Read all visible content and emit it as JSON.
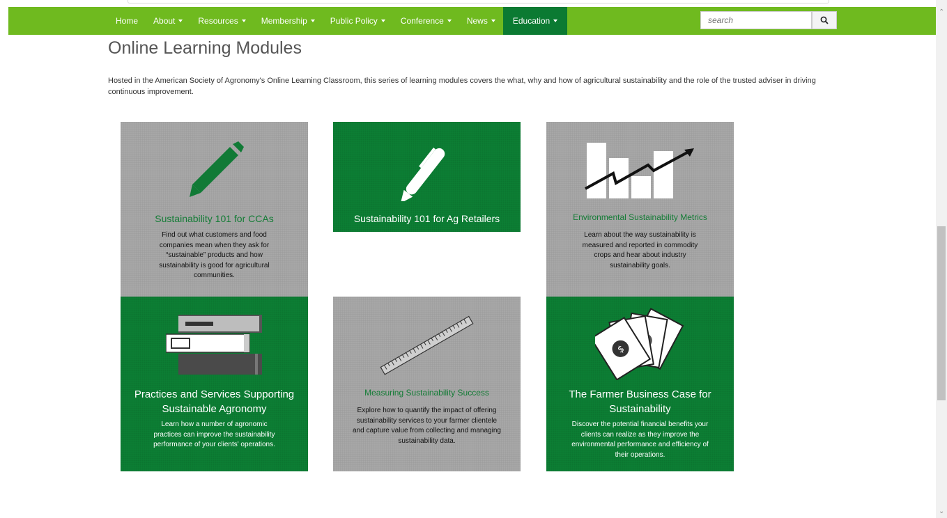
{
  "nav": {
    "items": [
      {
        "label": "Home",
        "caret": false
      },
      {
        "label": "About",
        "caret": true
      },
      {
        "label": "Resources",
        "caret": true
      },
      {
        "label": "Membership",
        "caret": true
      },
      {
        "label": "Public Policy",
        "caret": true
      },
      {
        "label": "Conference",
        "caret": true
      },
      {
        "label": "News",
        "caret": true
      },
      {
        "label": "Education",
        "caret": true,
        "active": true
      }
    ],
    "search_placeholder": "search",
    "search_icon": "magnifier-icon"
  },
  "colors": {
    "nav": "#6fba1f",
    "nav_active": "#0b7a32",
    "tile_green": "#0c7e34",
    "tile_gray": "#a7a7a7",
    "title_green": "#147c36"
  },
  "page": {
    "title": "Online Learning Modules",
    "intro": "Hosted in the American Society of Agronomy's Online Learning Classroom, this series of learning modules covers the what, why and how of agricultural sustainability and the role of the trusted adviser in driving continuous improvement."
  },
  "modules": [
    {
      "title": "Sustainability 101 for CCAs",
      "desc": "Find out what customers and food companies mean when they ask for “sustainable” products and how sustainability is good for agricultural communities.",
      "icon": "pencil-icon",
      "style": "gray"
    },
    {
      "title": "Sustainability 101 for Ag Retailers",
      "desc": "",
      "icon": "pen-icon",
      "style": "green"
    },
    {
      "title": "Environmental Sustainability Metrics",
      "desc": "Learn about the way sustainability is measured and reported in commodity crops and hear about industry sustainability goals.",
      "icon": "bar-chart-icon",
      "style": "gray"
    },
    {
      "title": "Practices and Services Supporting Sustainable Agronomy",
      "desc": "Learn how a number of agronomic practices can improve the sustainability performance of your clients' operations.",
      "icon": "books-icon",
      "style": "green"
    },
    {
      "title": "Measuring Sustainability Success",
      "desc": "Explore how to quantify the impact of offering sustainability services to your farmer clientele and capture value from collecting and managing sustainability data.",
      "icon": "ruler-icon",
      "style": "gray"
    },
    {
      "title": "The Farmer Business Case for Sustainability",
      "desc": "Discover the potential financial benefits your clients can realize as they improve the environmental performance and efficiency of their operations.",
      "icon": "money-icon",
      "style": "green"
    }
  ]
}
